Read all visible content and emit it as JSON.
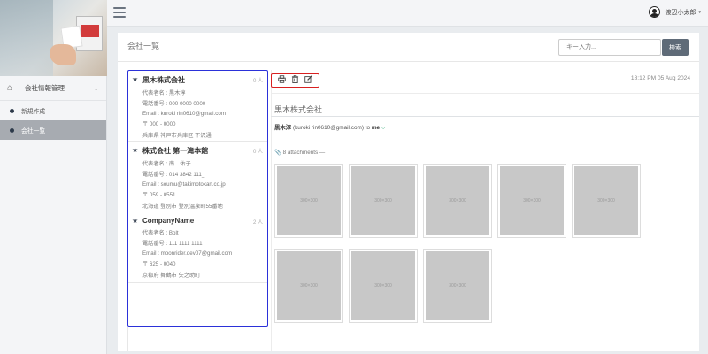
{
  "topbar": {
    "user_name": "渡辺小太郎",
    "user_caret": "▾"
  },
  "sidebar": {
    "group_label": "会社情報管理",
    "group_chevron": "⌄",
    "items": [
      {
        "label": "新規作成",
        "active": false
      },
      {
        "label": "会社一覧",
        "active": true
      }
    ]
  },
  "main": {
    "title": "会社一覧",
    "search_placeholder": "キー入力...",
    "search_button": "検索"
  },
  "companies": [
    {
      "name": "黒木株式会社",
      "count": "0 人",
      "representative": "代表者名 : 黒木淳",
      "phone": "電話番号 : 000 0000 0000",
      "email": "Email : kuroki rin0610@gmail.com",
      "postal": "〒 000 - 0000",
      "address": "兵庫県 神戸市兵庫区 下沢通"
    },
    {
      "name": "株式会社 第一滝本館",
      "count": "0 人",
      "representative": "代表者名 : 南　佑子",
      "phone": "電話番号 : 014 3842 111_",
      "email": "Email : soumu@takimotokan.co.jp",
      "postal": "〒 059 - 0551",
      "address": "北海道 登別市 登別温泉町55番地"
    },
    {
      "name": "CompanyName",
      "count": "2 人",
      "representative": "代表者名 : Bolt",
      "phone": "電話番号 : 111 1111 1111",
      "email": "Email : moonrider.dev07@gmail.com",
      "postal": "〒 625 - 0040",
      "address": "京都府 舞鶴市 矢之助町"
    }
  ],
  "detail": {
    "date": "18:12 PM 05 Aug 2024",
    "title": "黒木株式会社",
    "sender_name": "黒木淳",
    "sender_email": "(kuroki rin0610@gmail.com)",
    "sender_to": "to",
    "sender_me": "me",
    "attachments_label": "8 attachments —",
    "thumbnails": [
      "300×300",
      "300×300",
      "300×300",
      "300×300",
      "300×300",
      "300×300",
      "300×300",
      "300×300"
    ]
  }
}
